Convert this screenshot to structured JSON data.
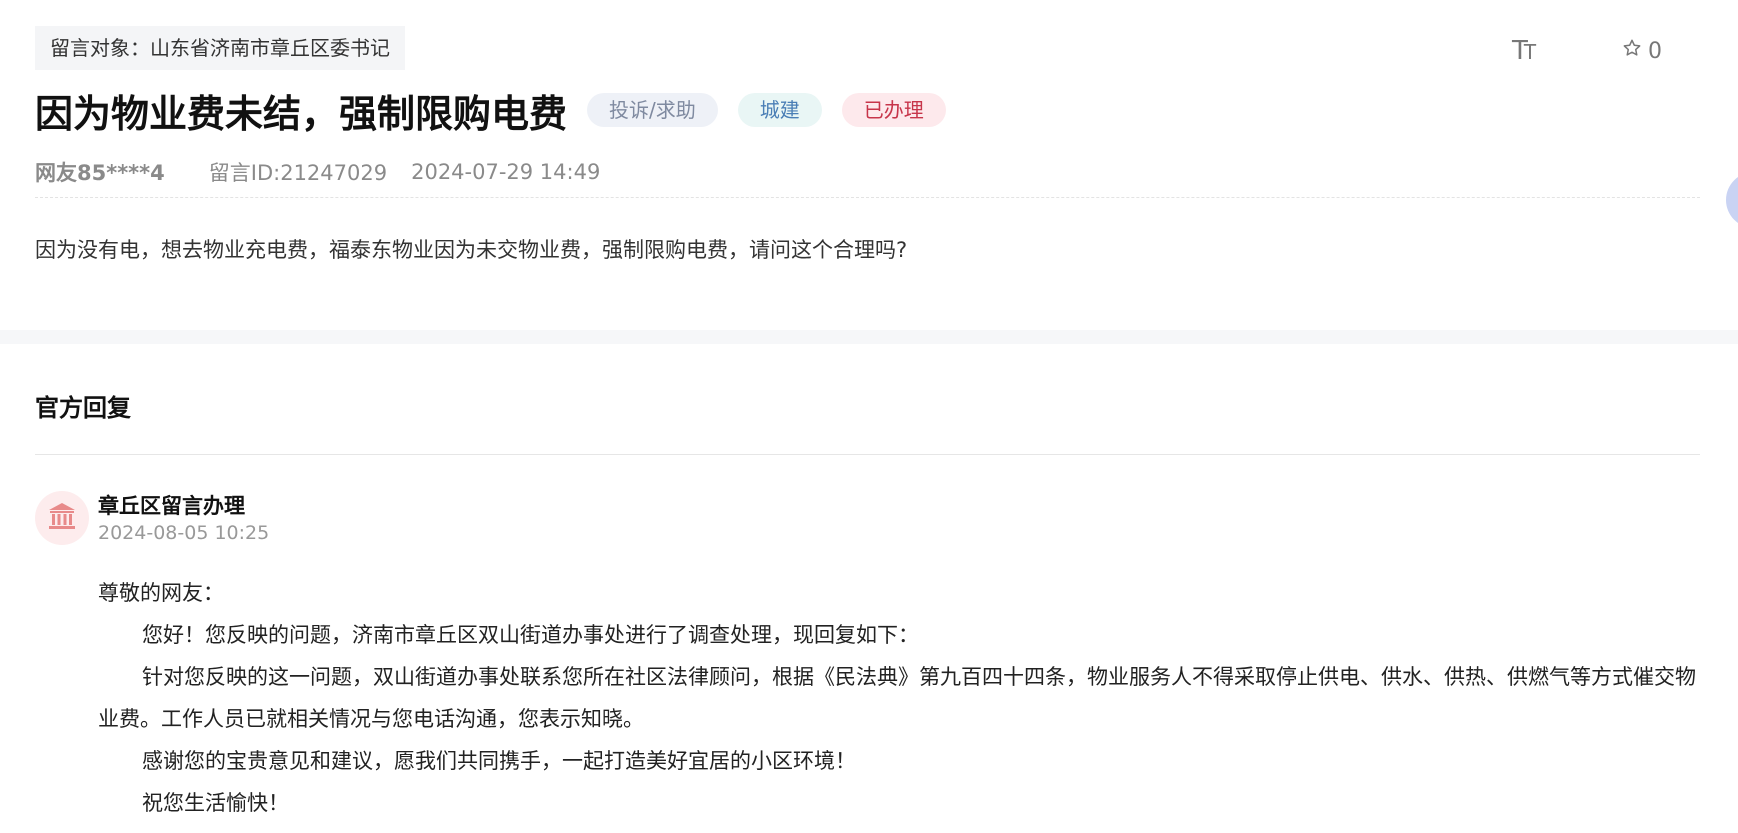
{
  "message": {
    "target_label": "留言对象：山东省济南市章丘区委书记",
    "title": "因为物业费未结，强制限购电费",
    "tags": {
      "type": "投诉/求助",
      "category": "城建",
      "status": "已办理"
    },
    "user": "网友85****4",
    "message_id": "留言ID:21247029",
    "datetime": "2024-07-29 14:49",
    "content": "因为没有电，想去物业充电费，福泰东物业因为未交物业费，强制限购电费，请问这个合理吗?"
  },
  "toolbar": {
    "font_size_icon": "font-size-icon",
    "font_size_big": "T",
    "font_size_small": "T",
    "favorite_icon": "star-outline-icon",
    "favorite_count": "0"
  },
  "reply": {
    "heading": "官方回复",
    "avatar_icon": "government-building-icon",
    "department": "章丘区留言办理",
    "datetime": "2024-08-05 10:25",
    "greeting": "尊敬的网友：",
    "paragraphs": [
      "您好！您反映的问题，济南市章丘区双山街道办事处进行了调查处理，现回复如下：",
      "针对您反映的这一问题，双山街道办事处联系您所在社区法律顾问，根据《民法典》第九百四十四条，物业服务人不得采取停止供电、供水、供热、供燃气等方式催交物业费。工作人员已就相关情况与您电话沟通，您表示知晓。",
      "感谢您的宝贵意见和建议，愿我们共同携手，一起打造美好宜居的小区环境！",
      "祝您生活愉快！"
    ]
  },
  "colors": {
    "tag_type_bg": "#eef1f7",
    "tag_category_bg": "#e9f6f5",
    "tag_status_bg": "#fde9ec",
    "tag_status_text": "#c7354a",
    "avatar_icon": "#e88a8a"
  }
}
